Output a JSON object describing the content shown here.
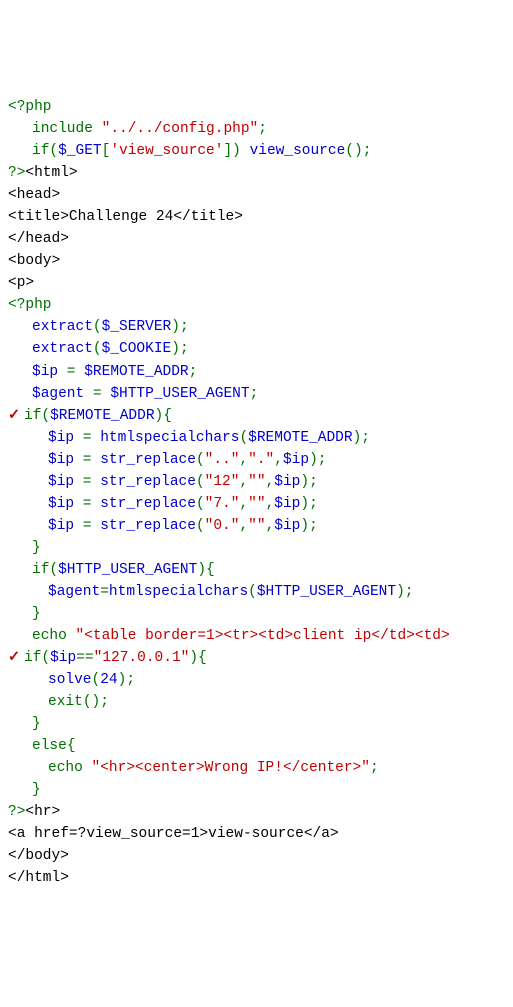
{
  "code": {
    "l1_open": "<?php",
    "l2_kw": "include",
    "l2_str": "\"../../config.php\"",
    "l2_end": ";",
    "l3_kw": "if",
    "l3_p1": "(",
    "l3_var1": "$_GET",
    "l3_brk1": "[",
    "l3_str": "'view_source'",
    "l3_brk2": "]",
    "l3_p2": ") ",
    "l3_func": "view_source",
    "l3_p3": "()",
    "l3_end": ";",
    "l4": "?><html>",
    "l5": "<head>",
    "l6": "<title>Challenge 24</title>",
    "l7": "</head>",
    "l8": "<body>",
    "l9": "<p>",
    "l10": "<?php",
    "l11_f": "extract",
    "l11_p": "(",
    "l11_v": "$_SERVER",
    "l11_e": ");",
    "l12_f": "extract",
    "l12_p": "(",
    "l12_v": "$_COOKIE",
    "l12_e": ");",
    "l13_v1": "$ip",
    "l13_eq": " = ",
    "l13_v2": "$REMOTE_ADDR",
    "l13_e": ";",
    "l14_v1": "$agent",
    "l14_eq": " = ",
    "l14_v2": "$HTTP_USER_AGENT",
    "l14_e": ";",
    "l15_chk": "✓",
    "l15_kw": "if",
    "l15_p1": "(",
    "l15_v": "$REMOTE_ADDR",
    "l15_p2": "){",
    "l16_v1": "$ip",
    "l16_eq": " = ",
    "l16_f": "htmlspecialchars",
    "l16_p1": "(",
    "l16_v2": "$REMOTE_ADDR",
    "l16_p2": ")",
    "l16_e": ";",
    "l17_v1": "$ip",
    "l17_eq": " = ",
    "l17_f": "str_replace",
    "l17_p1": "(",
    "l17_s1": "\"..\"",
    "l17_c": ",",
    "l17_s2": "\".\"",
    "l17_v2": "$ip",
    "l17_p2": ")",
    "l17_e": ";",
    "l18_s1": "\"12\"",
    "l18_s2": "\"\"",
    "l19_s1": "\"7.\"",
    "l19_s2": "\"\"",
    "l20_s1": "\"0.\"",
    "l20_s2": "\"\"",
    "l21": "}",
    "l22_kw": "if",
    "l22_p1": "(",
    "l22_v": "$HTTP_USER_AGENT",
    "l22_p2": "){",
    "l23_v1": "$agent",
    "l23_eq": "=",
    "l23_f": "htmlspecialchars",
    "l23_p1": "(",
    "l23_v2": "$HTTP_USER_AGENT",
    "l23_p2": ")",
    "l23_e": ";",
    "l24": "}",
    "l25_kw": "echo",
    "l25_str": "\"<table border=1><tr><td>client ip</td><td>",
    "l26_chk": "✓",
    "l26_kw": "if",
    "l26_p1": "(",
    "l26_v": "$ip",
    "l26_eq": "==",
    "l26_str": "\"127.0.0.1\"",
    "l26_p2": "){",
    "l27_f": "solve",
    "l27_p1": "(",
    "l27_n": "24",
    "l27_p2": ")",
    "l27_e": ";",
    "l28_kw": "exit",
    "l28_p": "()",
    "l28_e": ";",
    "l29": "}",
    "l30_kw": "else",
    "l30_b": "{",
    "l31_kw": "echo",
    "l31_str": "\"<hr><center>Wrong IP!</center>\"",
    "l31_e": ";",
    "l32": "}",
    "l33": "?><hr>",
    "l34": "<a href=?view_source=1>view-source</a>",
    "l35": "</body>",
    "l36": "</html>"
  }
}
